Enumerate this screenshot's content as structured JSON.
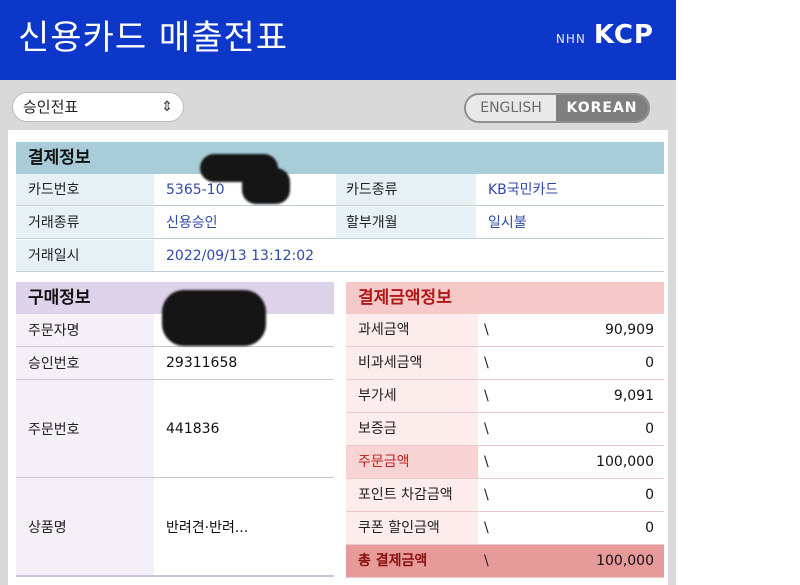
{
  "header": {
    "title": "신용카드 매출전표",
    "logo_prefix": "NHN",
    "logo_main": "KCP"
  },
  "receipt_select": {
    "value": "승인전표",
    "chevron": "updown-chevron-icon"
  },
  "lang_toggle": {
    "english": "ENGLISH",
    "korean": "KOREAN"
  },
  "payment_info": {
    "title": "결제정보",
    "rows": [
      {
        "label1": "카드번호",
        "value1": "5365-10",
        "label2": "카드종류",
        "value2": "KB국민카드"
      },
      {
        "label1": "거래종류",
        "value1": "신용승인",
        "label2": "할부개월",
        "value2": "일시불"
      },
      {
        "label1": "거래일시",
        "value1": "2022/09/13 13:12:02"
      }
    ]
  },
  "purchase_info": {
    "title": "구매정보",
    "rows": [
      {
        "label": "주문자명",
        "value": ""
      },
      {
        "label": "승인번호",
        "value": "29311658"
      },
      {
        "label": "주문번호",
        "value": "441836"
      },
      {
        "label": "상품명",
        "value": "반려견·반려..."
      }
    ]
  },
  "amount_info": {
    "title": "결제금액정보",
    "currency": "\\",
    "rows": [
      {
        "label": "과세금액",
        "amount": "90,909"
      },
      {
        "label": "비과세금액",
        "amount": "0"
      },
      {
        "label": "부가세",
        "amount": "9,091"
      },
      {
        "label": "보증금",
        "amount": "0"
      },
      {
        "label": "주문금액",
        "amount": "100,000"
      },
      {
        "label": "포인트 차감금액",
        "amount": "0"
      },
      {
        "label": "쿠폰 할인금액",
        "amount": "0"
      },
      {
        "label": "총 결제금액",
        "amount": "100,000"
      }
    ]
  },
  "colors": {
    "header_bg": "#0d37c9",
    "payment_head": "#a9ccd9",
    "purchase_head": "#ddd3ea",
    "amount_head": "#f6c9c9",
    "total_row": "#e79a9a"
  }
}
